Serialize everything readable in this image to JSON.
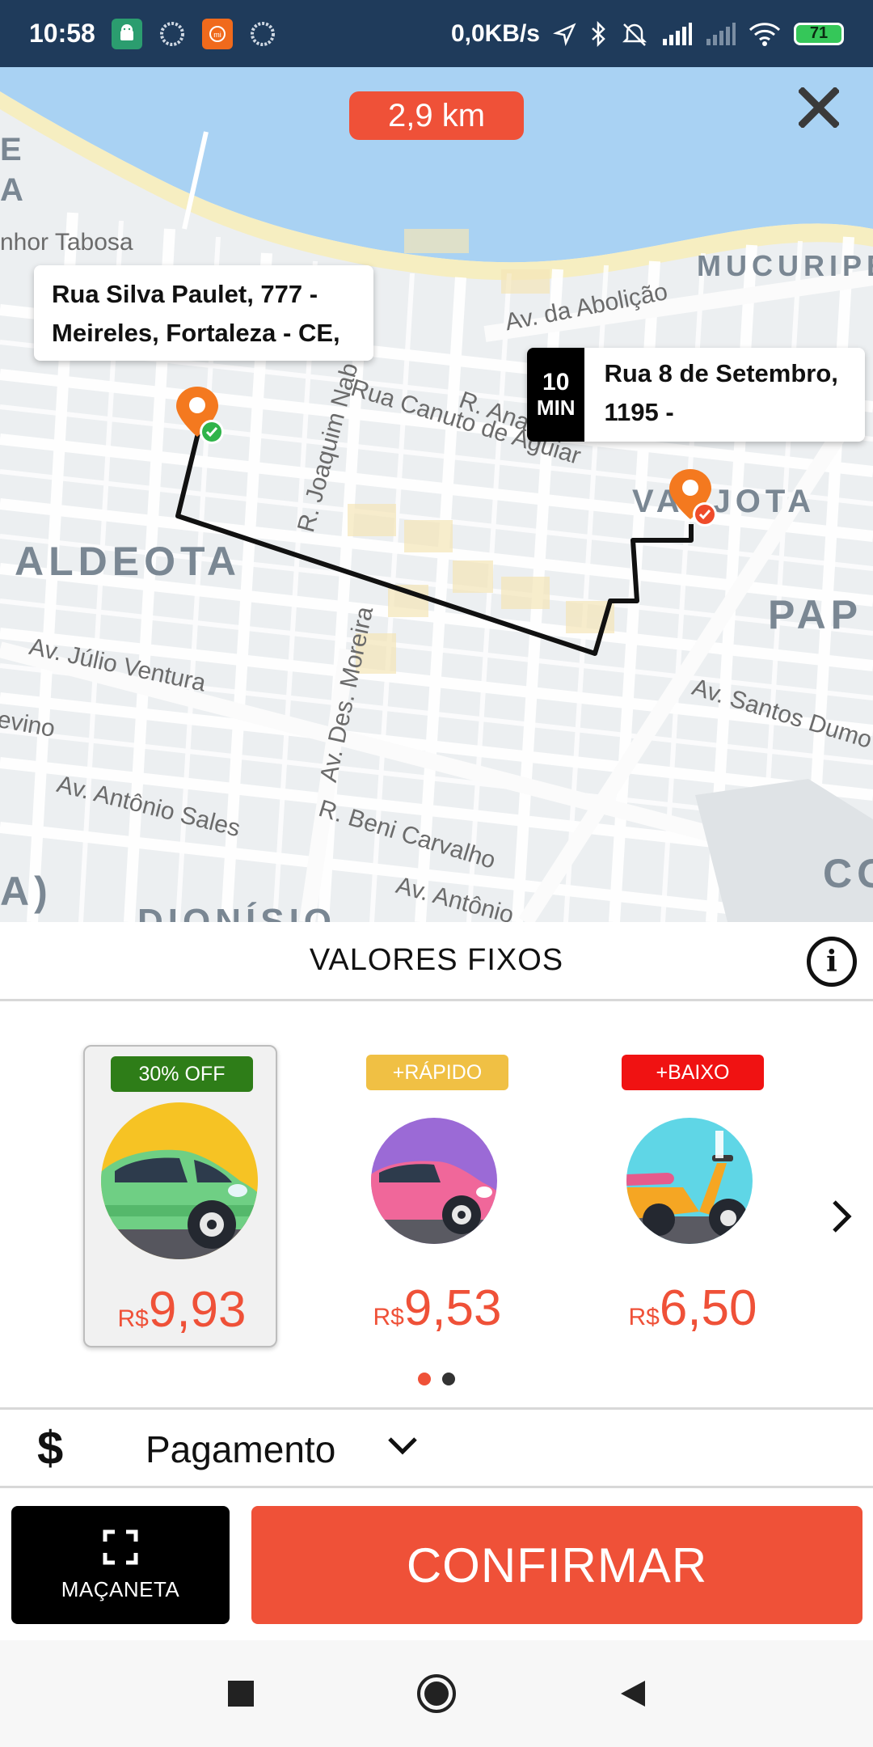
{
  "status_bar": {
    "time": "10:58",
    "network_speed": "0,0KB/s",
    "battery": "71",
    "icons_left": [
      "android-icon",
      "circle-icon",
      "mi-icon",
      "circle-icon"
    ],
    "icons_right": [
      "location-arrow-icon",
      "bluetooth-icon",
      "mute-icon",
      "signal-icon",
      "signal-icon",
      "wifi-icon",
      "battery-icon"
    ]
  },
  "map": {
    "distance": "2,9 km",
    "origin_address": "Rua Silva Paulet, 777 - Meireles, Fortaleza - CE,",
    "destination_address": "Rua 8 de Setembro, 1195 -",
    "eta_value": "10",
    "eta_unit": "MIN",
    "labels": {
      "neighborhood_aldeota": "ALDEOTA",
      "neighborhood_mucuripe": "MUCURIPE",
      "neighborhood_varjota": "VARJOTA",
      "neighborhood_pap": "PAP",
      "neighborhood_co": "CO",
      "neighborhood_dionisio": "DIONÍSIO",
      "st_tabosa": "nhor Tabosa",
      "st_abolicao": "Av. da Abolição",
      "st_canuto": "Rua Canuto de Aguiar",
      "st_joaquim": "R. Joaquim Nab",
      "st_ana": "R. Ana",
      "st_julio": "Av. Júlio Ventura",
      "st_evino": "evino",
      "st_moreira": "Av. Des. Moreira",
      "st_santos": "Av. Santos Dumo",
      "st_antonio_sales": "Av. Antônio Sales",
      "st_beni": "R. Beni Carvalho",
      "st_antonio2": "Av. Antônio",
      "edge_e": "E",
      "edge_a": "A",
      "edge_a2": "A)"
    },
    "accent_color": "#ef5138"
  },
  "fares": {
    "header": "VALORES FIXOS",
    "currency": "R$",
    "options": [
      {
        "badge": "30% OFF",
        "badge_color": "#2e7d18",
        "price": "9,93",
        "vehicle": "car-green-icon",
        "selected": true
      },
      {
        "badge": "+RÁPIDO",
        "badge_color": "#f0c044",
        "price": "9,53",
        "vehicle": "car-pink-icon",
        "selected": false
      },
      {
        "badge": "+BAIXO",
        "badge_color": "#f01212",
        "price": "6,50",
        "vehicle": "scooter-icon",
        "selected": false
      }
    ],
    "page_count": 2,
    "active_page": 1
  },
  "payment": {
    "icon": "$",
    "label": "Pagamento"
  },
  "actions": {
    "handle_label": "MAÇANETA",
    "confirm_label": "CONFIRMAR"
  }
}
